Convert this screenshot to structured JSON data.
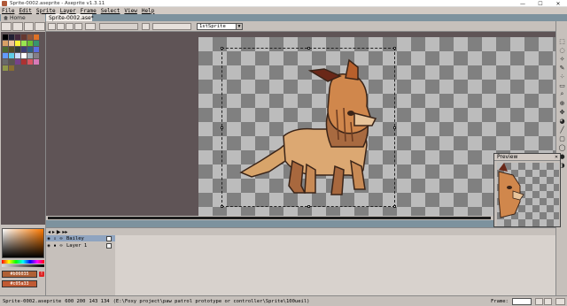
{
  "window": {
    "title": "Sprite-0002.aseprite - Aseprite v1.3.11",
    "minimize": "—",
    "maximize": "☐",
    "close": "✕"
  },
  "menu": [
    "File",
    "Edit",
    "Sprite",
    "Layer",
    "Frame",
    "Select",
    "View",
    "Help"
  ],
  "tabs": [
    {
      "label": "Home",
      "icon": "home-icon"
    },
    {
      "label": "Sprite-0002.ase*",
      "icon": "sprite-icon"
    }
  ],
  "context_bar": {
    "auto_select_value": "1stSprite"
  },
  "colors": {
    "fg_hex": "#b06035",
    "bg_hex": "#c05a33",
    "fg_label": "#b06035",
    "bg_label": "#c05a33",
    "palette": [
      "#000000",
      "#222034",
      "#45283c",
      "#663931",
      "#8f563b",
      "#df7126",
      "#d9a066",
      "#eec39a",
      "#fbf236",
      "#99e550",
      "#6abe30",
      "#37946e",
      "#4b692f",
      "#524b24",
      "#323c39",
      "#3f3f74",
      "#306082",
      "#5b6ee1",
      "#639bff",
      "#5fcde4",
      "#cbdbfc",
      "#ffffff",
      "#9badb7",
      "#847e87",
      "#696a6a",
      "#595652",
      "#76428a",
      "#ac3232",
      "#d95763",
      "#d77bba",
      "#8f974a",
      "#8a6f30"
    ]
  },
  "preview": {
    "title": "Preview"
  },
  "layers": [
    {
      "name": "Bailey",
      "selected": true
    },
    {
      "name": "Layer 1",
      "selected": false
    }
  ],
  "status": {
    "file": "Sprite-0002.aseprite",
    "size": "600 200",
    "pos": "143 134",
    "path": "(E:\\Foxy project\\paw patrol prototype or controller\\Sprite\\100ueil)",
    "frame_label": "Frame:",
    "frame_value": "1"
  },
  "tools": [
    "marquee-icon",
    "lasso-icon",
    "wand-icon",
    "pencil-icon",
    "spray-icon",
    "eraser-icon",
    "eyedropper-icon",
    "zoom-icon",
    "move-icon",
    "bucket-icon",
    "line-icon",
    "rect-icon",
    "ellipse-icon",
    "blur-icon",
    "contour-icon"
  ]
}
